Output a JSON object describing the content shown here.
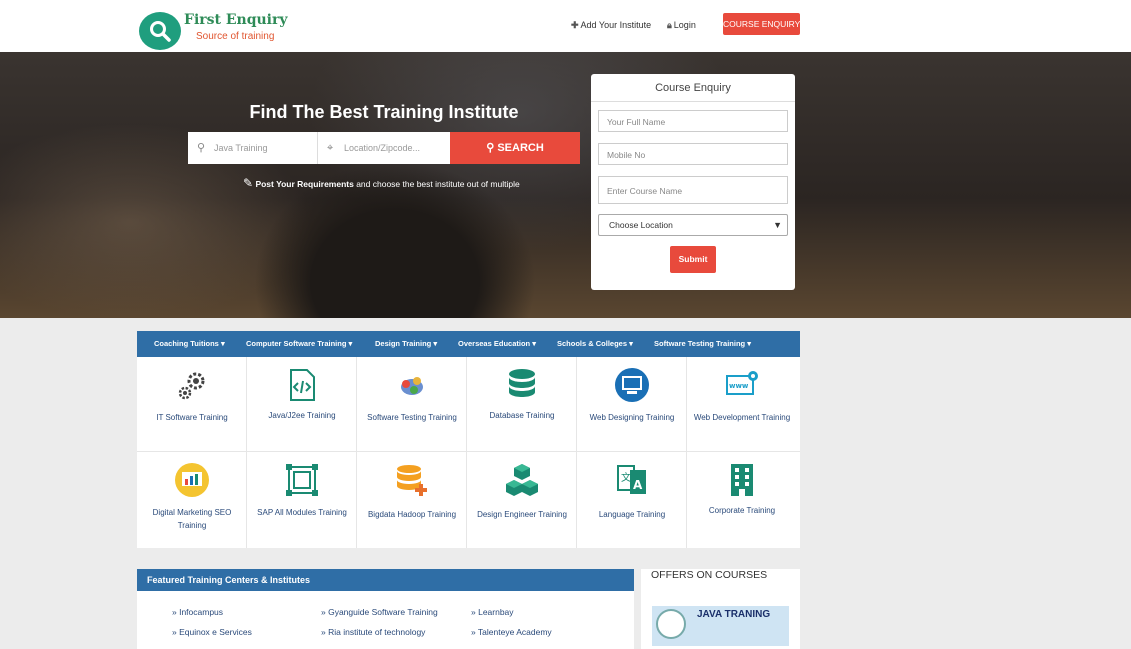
{
  "header": {
    "logo_title": "First Enquiry",
    "logo_subtitle": "Source of training",
    "add_institute": "Add Your Institute",
    "login": "Login",
    "course_enquiry_button": "COURSE ENQUIRY"
  },
  "hero": {
    "title": "Find The Best Training Institute",
    "search_course_placeholder": "Java Training",
    "search_location_placeholder": "Location/Zipcode...",
    "search_button": "SEARCH",
    "post_link": "Post Your Requirements",
    "post_text": " and choose the best institute out of multiple"
  },
  "enquiry_form": {
    "title": "Course Enquiry",
    "full_name_placeholder": "Your Full Name",
    "mobile_placeholder": "Mobile No",
    "course_placeholder": "Enter Course Name",
    "location_select": "Choose Location",
    "submit": "Submit"
  },
  "category_nav": [
    "Coaching Tuitions ▾",
    "Computer Software Training ▾",
    "Design Training ▾",
    "Overseas Education ▾",
    "Schools & Colleges ▾",
    "Software Testing Training ▾"
  ],
  "categories": [
    {
      "label": "IT Software Training",
      "icon": "gears-icon"
    },
    {
      "label": "Java/J2ee Training",
      "icon": "code-file-icon"
    },
    {
      "label": "Software Testing Training",
      "icon": "bug-test-icon"
    },
    {
      "label": "Database Training",
      "icon": "database-icon"
    },
    {
      "label": "Web Designing Training",
      "icon": "web-design-icon"
    },
    {
      "label": "Web Development Training",
      "icon": "web-development-icon"
    },
    {
      "label": "Digital Marketing SEO Training",
      "icon": "seo-chart-icon"
    },
    {
      "label": "SAP All Modules Training",
      "icon": "modules-icon"
    },
    {
      "label": "Bigdata Hadoop Training",
      "icon": "bigdata-icon"
    },
    {
      "label": "Design Engineer Training",
      "icon": "cubes-icon"
    },
    {
      "label": "Language Training",
      "icon": "language-icon"
    },
    {
      "label": "Corporate Training",
      "icon": "building-icon"
    }
  ],
  "featured": {
    "title": "Featured Training Centers & Institutes",
    "items": [
      "» Infocampus",
      "» Gyanguide Software Training",
      "» Learnbay",
      "» Equinox e Services",
      "» Ria institute of technology",
      "» Talenteye Academy"
    ]
  },
  "offers": {
    "title": "OFFERS ON COURSES",
    "banner_text": "JAVA TRANING"
  },
  "colors": {
    "accent": "#e84a3c",
    "nav_blue": "#2f6ea6",
    "logo_green": "#1f9e7e"
  }
}
